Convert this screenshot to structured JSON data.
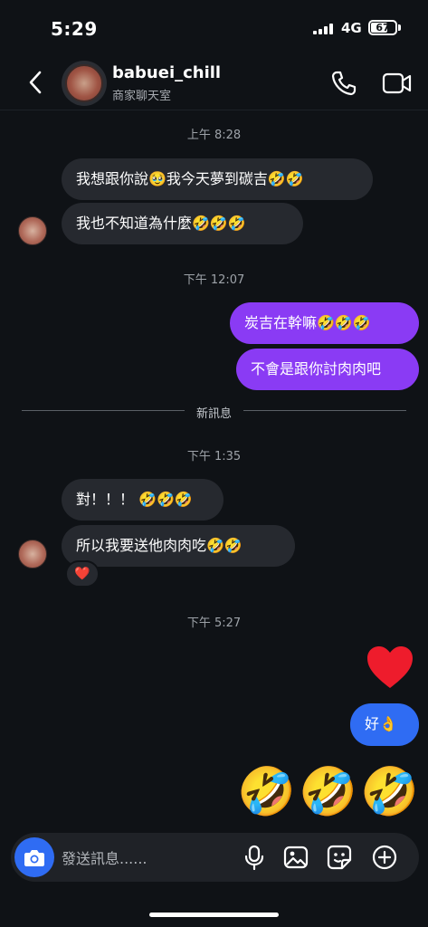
{
  "status_bar": {
    "time": "5:29",
    "network": "4G",
    "battery": "67"
  },
  "header": {
    "name": "babuei_chill",
    "subtitle": "商家聊天室",
    "icons": [
      "back-arrow-icon",
      "phone-icon",
      "video-camera-icon"
    ]
  },
  "messages": {
    "ts1": "上午 8:28",
    "m1": "我想跟你說🥹我今天夢到碳吉🤣🤣",
    "m2": "我也不知道為什麼🤣🤣🤣",
    "ts2": "下午 12:07",
    "m3": "炭吉在幹嘛🤣🤣🤣",
    "m4": "不會是跟你討肉肉吧",
    "new_divider": "新訊息",
    "ts3": "下午 1:35",
    "m5": "對！！！ 🤣🤣🤣",
    "m6": "所以我要送他肉肉吃🤣🤣",
    "reaction": "❤️",
    "ts4": "下午 5:27",
    "m7_big_heart": "❤️",
    "m8": "好👌",
    "m9_emojis": [
      "🤣",
      "🤣",
      "🤣"
    ]
  },
  "composer": {
    "placeholder": "發送訊息......",
    "icons": [
      "camera-icon",
      "microphone-icon",
      "image-icon",
      "sticker-icon",
      "plus-icon"
    ]
  },
  "colors": {
    "incoming": "#26292f",
    "outgoing_purple": "#8a3bf4",
    "outgoing_blue": "#2f6cf3",
    "background": "#0f1216",
    "heart": "#ee1c2c"
  }
}
